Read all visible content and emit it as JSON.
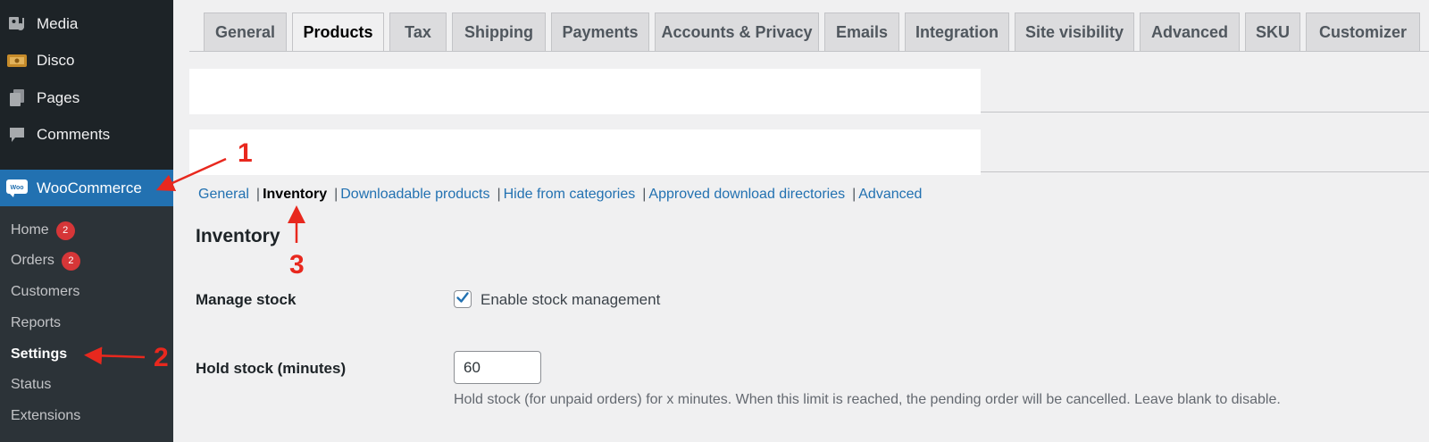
{
  "sidebar": {
    "items": [
      {
        "label": "Media",
        "icon": "media-icon"
      },
      {
        "label": "Disco",
        "icon": "ticket-icon"
      },
      {
        "label": "Pages",
        "icon": "pages-icon"
      },
      {
        "label": "Comments",
        "icon": "comments-icon"
      },
      {
        "label": "WooCommerce",
        "icon": "woocommerce-icon",
        "icon_text": "Woo"
      }
    ],
    "submenu": [
      {
        "label": "Home",
        "badge": "2"
      },
      {
        "label": "Orders",
        "badge": "2"
      },
      {
        "label": "Customers"
      },
      {
        "label": "Reports"
      },
      {
        "label": "Settings"
      },
      {
        "label": "Status"
      },
      {
        "label": "Extensions"
      }
    ]
  },
  "tabs": [
    "General",
    "Products",
    "Tax",
    "Shipping",
    "Payments",
    "Accounts & Privacy",
    "Emails",
    "Integration",
    "Site visibility",
    "Advanced",
    "SKU",
    "Customizer"
  ],
  "active_tab": "Products",
  "subsections": [
    "General",
    "Inventory",
    "Downloadable products",
    "Hide from categories",
    "Approved download directories",
    "Advanced"
  ],
  "current_subsection": "Inventory",
  "section_title": "Inventory",
  "manage_stock": {
    "label": "Manage stock",
    "checkbox_label": "Enable stock management",
    "checked": true
  },
  "hold_stock": {
    "label": "Hold stock (minutes)",
    "value": "60",
    "description": "Hold stock (for unpaid orders) for x minutes. When this limit is reached, the pending order will be cancelled. Leave blank to disable."
  },
  "annotations": [
    "1",
    "2",
    "3"
  ],
  "colors": {
    "sidebar_bg": "#1d2327",
    "submenu_bg": "#2c3338",
    "accent": "#2271b1",
    "badge": "#d63638",
    "annotation": "#e8281e"
  }
}
